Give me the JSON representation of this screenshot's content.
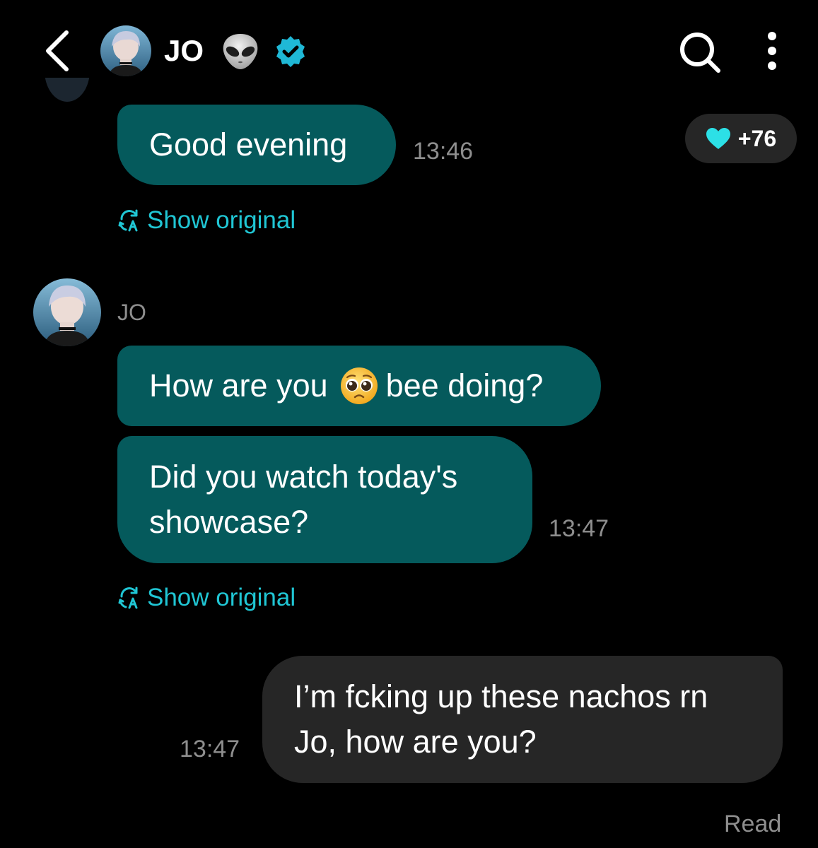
{
  "header": {
    "contact_name": "JO",
    "icons": [
      "back-icon",
      "avatar",
      "alien-emoji-icon",
      "verified-badge-icon",
      "search-icon",
      "more-options-icon"
    ]
  },
  "colors": {
    "background": "#000000",
    "incoming_bubble": "#055a5c",
    "outgoing_bubble": "#262626",
    "accent": "#20c6d4",
    "timestamp": "#8e8e8e"
  },
  "messages": [
    {
      "direction": "incoming",
      "lines": [
        "Good evening"
      ],
      "time": "13:46",
      "show_original_label": "Show original"
    },
    {
      "direction": "incoming",
      "sender": "JO",
      "lines_parts": [
        "How are you",
        "bee doing?"
      ],
      "emoji": "pleading-face-icon"
    },
    {
      "direction": "incoming",
      "lines": [
        "Did you watch today's",
        "showcase?"
      ],
      "time": "13:47",
      "show_original_label": "Show original"
    },
    {
      "direction": "outgoing",
      "lines": [
        "I’m fcking up these nachos rn",
        "Jo, how are you?"
      ],
      "time": "13:47",
      "status": "Read"
    }
  ],
  "reaction": {
    "icon": "heart-icon",
    "count": "+76"
  }
}
